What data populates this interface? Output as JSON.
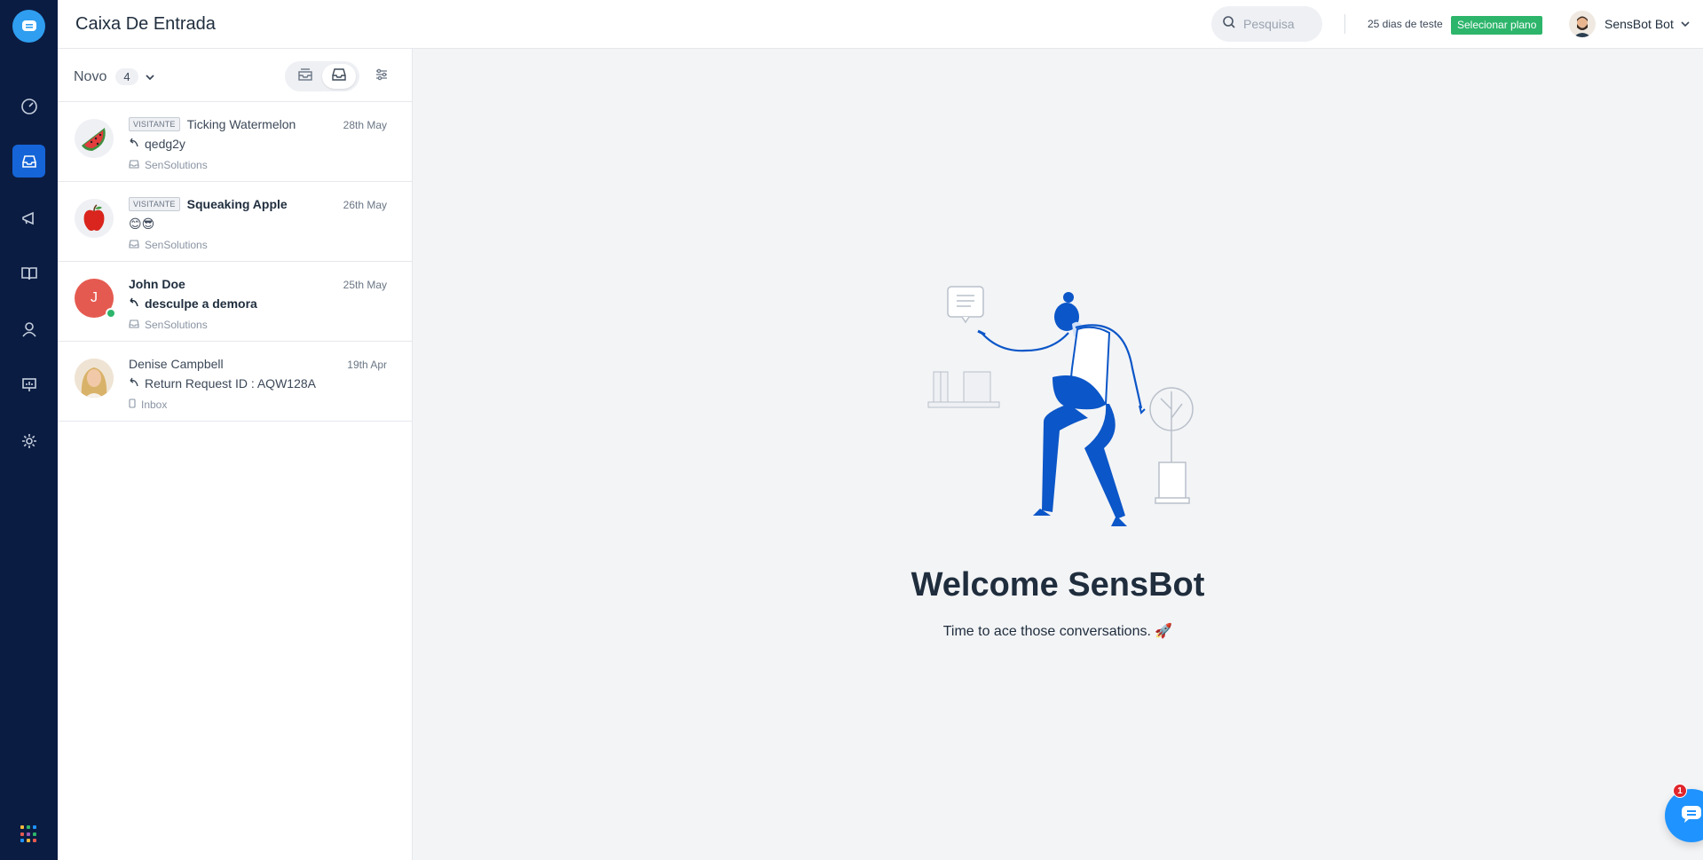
{
  "header": {
    "title": "Caixa De Entrada",
    "search_placeholder": "Pesquisa",
    "trial_text": "25 dias de teste",
    "plan_button": "Selecionar plano",
    "user_name": "SensBot Bot"
  },
  "list": {
    "status_label": "Novo",
    "count": "4",
    "conversations": [
      {
        "tag": "VISITANTE",
        "name": "Ticking Watermelon",
        "date": "28th May",
        "message": "qedg2y",
        "inbox": "SenSolutions",
        "avatar": "watermelon"
      },
      {
        "tag": "VISITANTE",
        "name": "Squeaking Apple",
        "date": "26th May",
        "message": "😊😎",
        "inbox": "SenSolutions",
        "avatar": "apple"
      },
      {
        "name": "John Doe",
        "date": "25th May",
        "message": "desculpe a demora",
        "inbox": "SenSolutions",
        "avatar_letter": "J"
      },
      {
        "name": "Denise Campbell",
        "date": "19th Apr",
        "message": "Return Request ID : AQW128A",
        "inbox": "Inbox",
        "avatar": "photo"
      }
    ]
  },
  "welcome": {
    "title": "Welcome SensBot",
    "subtitle": "Time to ace those conversations. 🚀"
  },
  "fab": {
    "badge": "1"
  },
  "colors": {
    "nav_bg": "#0b1c42",
    "accent": "#1565d8",
    "plan_green": "#2db56b",
    "fab_blue": "#1f93ff",
    "illustration_blue": "#0b56c8"
  }
}
